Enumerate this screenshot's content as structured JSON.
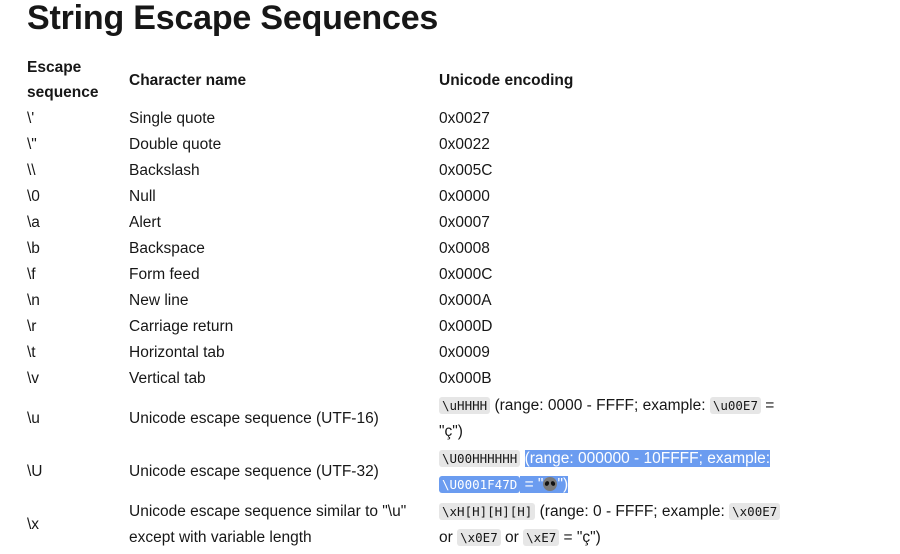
{
  "title": "String Escape Sequences",
  "table": {
    "headers": {
      "escape": "Escape sequence",
      "name": "Character name",
      "encoding": "Unicode encoding"
    },
    "rows": [
      {
        "escape": "\\'",
        "name": "Single quote",
        "encoding": "0x0027"
      },
      {
        "escape": "\\\"",
        "name": "Double quote",
        "encoding": "0x0022"
      },
      {
        "escape": "\\\\",
        "name": "Backslash",
        "encoding": "0x005C"
      },
      {
        "escape": "\\0",
        "name": "Null",
        "encoding": "0x0000"
      },
      {
        "escape": "\\a",
        "name": "Alert",
        "encoding": "0x0007"
      },
      {
        "escape": "\\b",
        "name": "Backspace",
        "encoding": "0x0008"
      },
      {
        "escape": "\\f",
        "name": "Form feed",
        "encoding": "0x000C"
      },
      {
        "escape": "\\n",
        "name": "New line",
        "encoding": "0x000A"
      },
      {
        "escape": "\\r",
        "name": "Carriage return",
        "encoding": "0x000D"
      },
      {
        "escape": "\\t",
        "name": "Horizontal tab",
        "encoding": "0x0009"
      },
      {
        "escape": "\\v",
        "name": "Vertical tab",
        "encoding": "0x000B"
      }
    ],
    "u_row": {
      "escape": "\\u",
      "name": "Unicode escape sequence (UTF-16)",
      "code1": "\\uHHHH",
      "text1": " (range: 0000 - FFFF; example: ",
      "code2": "\\u00E7",
      "text2": " = \"ç\")"
    },
    "U_row": {
      "escape": "\\U",
      "name": "Unicode escape sequence (UTF-32)",
      "code1": "\\U00HHHHHH",
      "text1": "(range: 000000 - 10FFFF; example: ",
      "code2": "\\U0001F47D",
      "text2a": " = \"",
      "emoji": "alien-emoji",
      "text2b": "\")"
    },
    "x_row": {
      "escape": "\\x",
      "name": "Unicode escape sequence similar to \"\\u\" except with variable length",
      "code1": "\\xH[H][H][H]",
      "text1": " (range: 0 - FFFF; example: ",
      "code2": "\\x00E7",
      "or1": " or ",
      "code3": "\\x0E7",
      "or2": " or ",
      "code4": "\\xE7",
      "text2": " = \"ç\")"
    }
  },
  "colors": {
    "selection": "#6b9cf0",
    "code_bg": "#e6e6e6",
    "text": "#171717"
  }
}
